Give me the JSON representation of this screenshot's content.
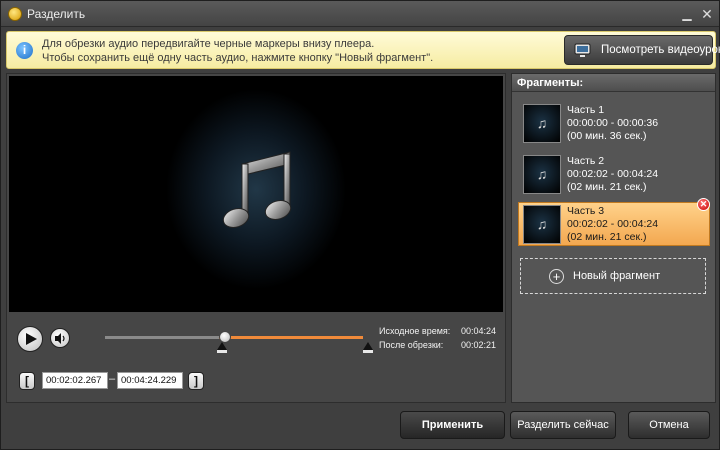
{
  "window": {
    "title": "Разделить",
    "minimize_glyph": "▁",
    "close_glyph": "✕"
  },
  "notice": {
    "line1": "Для обрезки аудио передвигайте черные маркеры внизу плеера.",
    "line2": "Чтобы сохранить ещё одну часть аудио, нажмите кнопку \"Новый фрагмент\".",
    "tutorial_label": "Посмотреть видеоурок",
    "info_glyph": "i"
  },
  "player": {
    "icon": "music-note-icon",
    "source_time_label": "Исходное время:",
    "source_time": "00:04:24",
    "cut_time_label": "После обрезки:",
    "cut_time": "00:02:21",
    "start_time": "00:02:02.267",
    "end_time": "00:04:24.229",
    "separator": "–",
    "bracket_left": "[",
    "bracket_right": "]",
    "selection_start_fraction": 0.46,
    "selection_end_fraction": 1.0
  },
  "fragments": {
    "header": "Фрагменты:",
    "items": [
      {
        "name": "Часть 1",
        "range": "00:00:00 - 00:00:36",
        "duration": "(00 мин. 36 сек.)",
        "thumb": "♫"
      },
      {
        "name": "Часть 2",
        "range": "00:02:02 - 00:04:24",
        "duration": "(02 мин. 21 сек.)",
        "thumb": "♫"
      },
      {
        "name": "Часть 3",
        "range": "00:02:02 - 00:04:24",
        "duration": "(02 мин. 21 сек.)",
        "thumb": "♫"
      }
    ],
    "selected_index": 2,
    "delete_glyph": "✕",
    "new_fragment_label": "Новый фрагмент",
    "new_fragment_glyph": "+"
  },
  "actions": {
    "apply": "Применить",
    "split_now": "Разделить сейчас",
    "cancel": "Отмена"
  },
  "colors": {
    "accent": "#f08a3a",
    "selected_fragment": "#f3a850",
    "notice_bg": "#fffbd8"
  }
}
